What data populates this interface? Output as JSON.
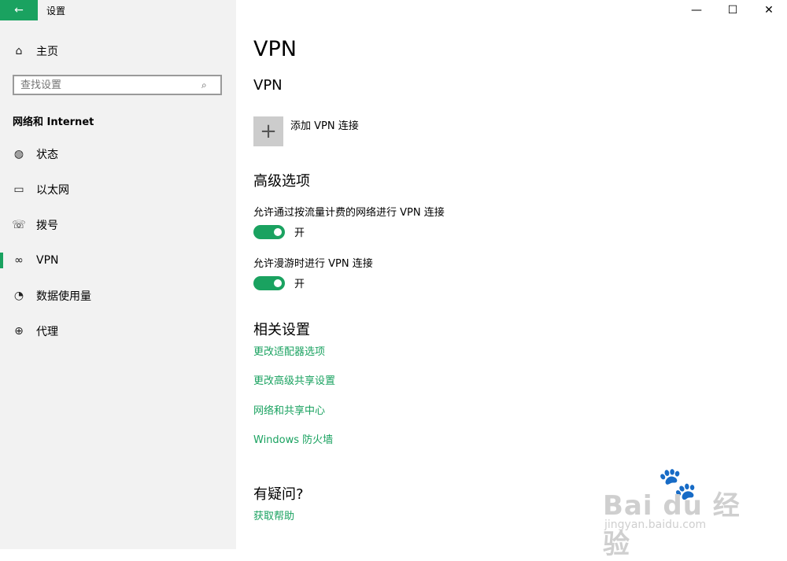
{
  "window": {
    "title": "设置",
    "back_icon": "arrow-left-icon",
    "minimize": "—",
    "maximize": "☐",
    "close": "✕"
  },
  "sidebar": {
    "home_label": "主页",
    "search_placeholder": "查找设置",
    "section_label": "网络和 Internet",
    "items": [
      {
        "label": "状态",
        "icon": "globe-status-icon"
      },
      {
        "label": "以太网",
        "icon": "ethernet-icon"
      },
      {
        "label": "拨号",
        "icon": "dialup-icon"
      },
      {
        "label": "VPN",
        "icon": "vpn-icon",
        "selected": true
      },
      {
        "label": "数据使用量",
        "icon": "data-usage-icon"
      },
      {
        "label": "代理",
        "icon": "globe-proxy-icon"
      }
    ]
  },
  "main": {
    "page_title": "VPN",
    "vpn_heading": "VPN",
    "add_vpn_label": "添加 VPN 连接",
    "advanced_title": "高级选项",
    "options": [
      {
        "label": "允许通过按流量计费的网络进行 VPN 连接",
        "state": "开",
        "on": true
      },
      {
        "label": "允许漫游时进行 VPN 连接",
        "state": "开",
        "on": true
      }
    ],
    "related_title": "相关设置",
    "related_links": [
      "更改适配器选项",
      "更改高级共享设置",
      "网络和共享中心",
      "Windows 防火墙"
    ],
    "help_title": "有疑问?",
    "help_link": "获取帮助"
  },
  "watermark": {
    "brand": "Bai du 经验",
    "url": "jingyan.baidu.com"
  },
  "colors": {
    "accent": "#1aa260",
    "sidebar_bg": "#f2f2f2"
  }
}
